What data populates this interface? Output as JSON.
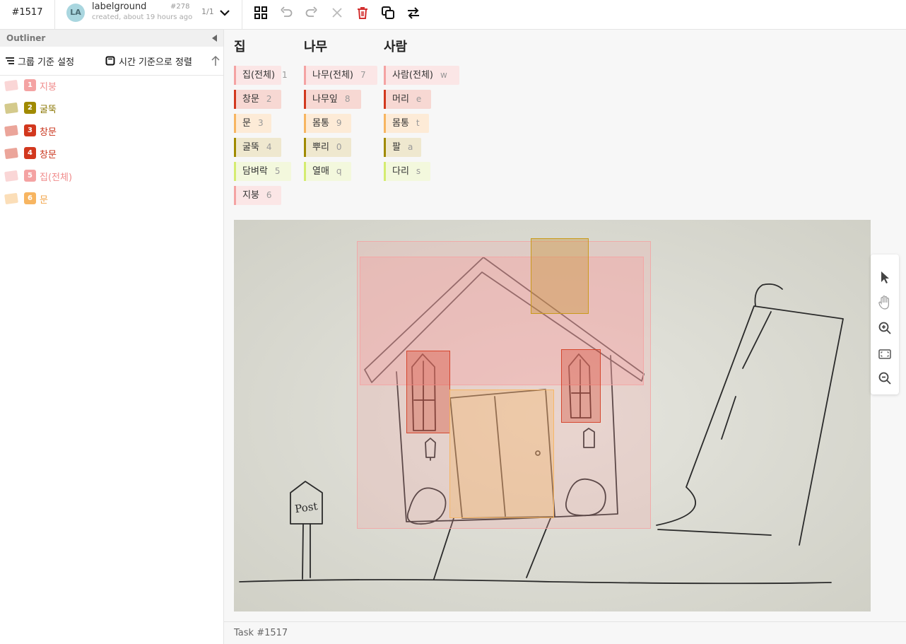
{
  "header": {
    "task_id": "#1517",
    "avatar_initials": "LA",
    "project_name": "labelground",
    "project_number": "#278",
    "project_subtitle": "created, about 19 hours ago",
    "pager": "1/1"
  },
  "toolbar": {
    "icons": [
      "grid-icon",
      "undo-icon",
      "redo-icon",
      "close-icon",
      "trash-icon",
      "copy-icon",
      "swap-icon"
    ],
    "delete_color": "#d32f2f"
  },
  "outliner": {
    "title": "Outliner",
    "group_setting": "그룹 기준 설정",
    "sort_by_time": "시간 기준으로 정렬",
    "items": [
      {
        "num": "1",
        "label": "지붕",
        "color": "#f4a3a3"
      },
      {
        "num": "2",
        "label": "굴뚝",
        "color": "#a08a00"
      },
      {
        "num": "3",
        "label": "창문",
        "color": "#d2381e"
      },
      {
        "num": "4",
        "label": "창문",
        "color": "#d2381e"
      },
      {
        "num": "5",
        "label": "집(전체)",
        "color": "#f4a3a3"
      },
      {
        "num": "6",
        "label": "문",
        "color": "#f7b561"
      }
    ]
  },
  "classes": {
    "house": {
      "title": "집",
      "chips": [
        {
          "label": "집(전체)",
          "key": "1",
          "color": "#f4a3a3"
        },
        {
          "label": "창문",
          "key": "2",
          "color": "#d2381e"
        },
        {
          "label": "문",
          "key": "3",
          "color": "#f7b561"
        },
        {
          "label": "굴뚝",
          "key": "4",
          "color": "#a08a00"
        },
        {
          "label": "담벼락",
          "key": "5",
          "color": "#d4ec70"
        },
        {
          "label": "지붕",
          "key": "6",
          "color": "#f4a3a3"
        }
      ]
    },
    "tree": {
      "title": "나무",
      "chips": [
        {
          "label": "나무(전체)",
          "key": "7",
          "color": "#f4a3a3"
        },
        {
          "label": "나무잎",
          "key": "8",
          "color": "#d2381e"
        },
        {
          "label": "몸통",
          "key": "9",
          "color": "#f7b561"
        },
        {
          "label": "뿌리",
          "key": "0",
          "color": "#a08a00"
        },
        {
          "label": "열매",
          "key": "q",
          "color": "#d4ec70"
        }
      ]
    },
    "person": {
      "title": "사람",
      "chips": [
        {
          "label": "사람(전체)",
          "key": "w",
          "color": "#f4a3a3"
        },
        {
          "label": "머리",
          "key": "e",
          "color": "#d2381e"
        },
        {
          "label": "몸통",
          "key": "t",
          "color": "#f7b561"
        },
        {
          "label": "팔",
          "key": "a",
          "color": "#a08a00"
        },
        {
          "label": "다리",
          "key": "s",
          "color": "#d4ec70"
        }
      ]
    }
  },
  "canvas": {
    "drawing_text": "Post"
  },
  "footer": {
    "task_label": "Task #1517"
  }
}
